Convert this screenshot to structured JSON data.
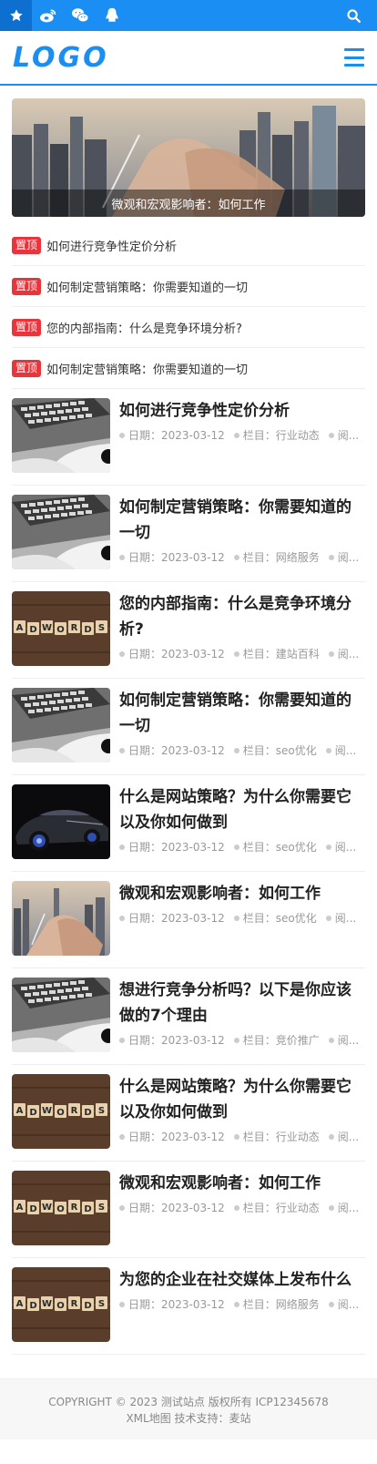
{
  "topbar": {
    "icons": [
      "star-icon",
      "weibo-icon",
      "wechat-icon",
      "qq-icon"
    ],
    "search_icon": "search-icon"
  },
  "header": {
    "logo": "LOGO",
    "menu_icon": "menu-icon"
  },
  "banner": {
    "caption": "微观和宏观影响者：如何工作"
  },
  "pinned": [
    {
      "tag": "置顶",
      "title": "如何进行竞争性定价分析"
    },
    {
      "tag": "置顶",
      "title": "如何制定营销策略：你需要知道的一切"
    },
    {
      "tag": "置顶",
      "title": "您的内部指南：什么是竞争环境分析?"
    },
    {
      "tag": "置顶",
      "title": "如何制定营销策略：你需要知道的一切"
    }
  ],
  "articles": [
    {
      "title": "如何进行竞争性定价分析",
      "date_label": "日期：",
      "date": "2023-03-12",
      "cat_label": "栏目：",
      "category": "行业动态",
      "views": "阅...",
      "thumb": "laptop"
    },
    {
      "title": "如何制定营销策略：你需要知道的一切",
      "date_label": "日期：",
      "date": "2023-03-12",
      "cat_label": "栏目：",
      "category": "网络服务",
      "views": "阅...",
      "thumb": "laptop"
    },
    {
      "title": "您的内部指南：什么是竞争环境分析?",
      "date_label": "日期：",
      "date": "2023-03-12",
      "cat_label": "栏目：",
      "category": "建站百科",
      "views": "阅...",
      "thumb": "adwords"
    },
    {
      "title": "如何制定营销策略：你需要知道的一切",
      "date_label": "日期：",
      "date": "2023-03-12",
      "cat_label": "栏目：",
      "category": "seo优化",
      "views": "阅...",
      "thumb": "laptop"
    },
    {
      "title": "什么是网站策略？为什么你需要它以及你如何做到",
      "date_label": "日期：",
      "date": "2023-03-12",
      "cat_label": "栏目：",
      "category": "seo优化",
      "views": "阅...",
      "thumb": "car"
    },
    {
      "title": "微观和宏观影响者：如何工作",
      "date_label": "日期：",
      "date": "2023-03-12",
      "cat_label": "栏目：",
      "category": "seo优化",
      "views": "阅...",
      "thumb": "handshake"
    },
    {
      "title": "想进行竞争分析吗？以下是你应该做的7个理由",
      "date_label": "日期：",
      "date": "2023-03-12",
      "cat_label": "栏目：",
      "category": "竞价推广",
      "views": "阅...",
      "thumb": "laptop"
    },
    {
      "title": "什么是网站策略？为什么你需要它以及你如何做到",
      "date_label": "日期：",
      "date": "2023-03-12",
      "cat_label": "栏目：",
      "category": "行业动态",
      "views": "阅...",
      "thumb": "adwords"
    },
    {
      "title": "微观和宏观影响者：如何工作",
      "date_label": "日期：",
      "date": "2023-03-12",
      "cat_label": "栏目：",
      "category": "行业动态",
      "views": "阅...",
      "thumb": "adwords"
    },
    {
      "title": "为您的企业在社交媒体上发布什么",
      "date_label": "日期：",
      "date": "2023-03-12",
      "cat_label": "栏目：",
      "category": "网络服务",
      "views": "阅...",
      "thumb": "adwords"
    }
  ],
  "footer": {
    "line1": "COPYRIGHT © 2023 测试站点 版权所有 ICP12345678",
    "line2": "XML地图 技术支持：麦站"
  }
}
